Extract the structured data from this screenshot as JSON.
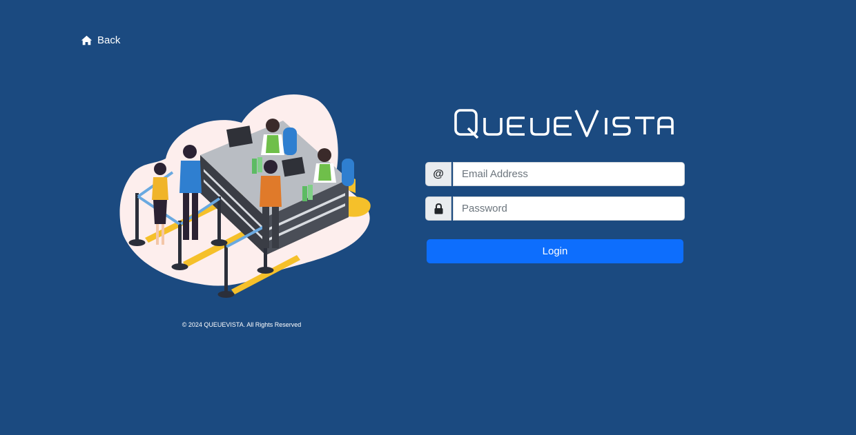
{
  "nav": {
    "back_label": "Back",
    "back_icon": "home-icon"
  },
  "brand": {
    "name": "QUEUEVISTA",
    "logo_text": "QueueVista"
  },
  "form": {
    "email_icon_glyph": "@",
    "email_placeholder": "Email Address",
    "email_value": "",
    "password_icon": "lock-icon",
    "password_placeholder": "Password",
    "password_value": "",
    "login_label": "Login"
  },
  "footer": {
    "copyright": "© 2024 QUEUEVISTA. All Rights Reserved"
  },
  "colors": {
    "background": "#1b4a80",
    "primary_button": "#0d6efd",
    "input_addon": "#e9ecef",
    "illustration_blob": "#fdeeed",
    "queue_line": "#f5c02a"
  }
}
